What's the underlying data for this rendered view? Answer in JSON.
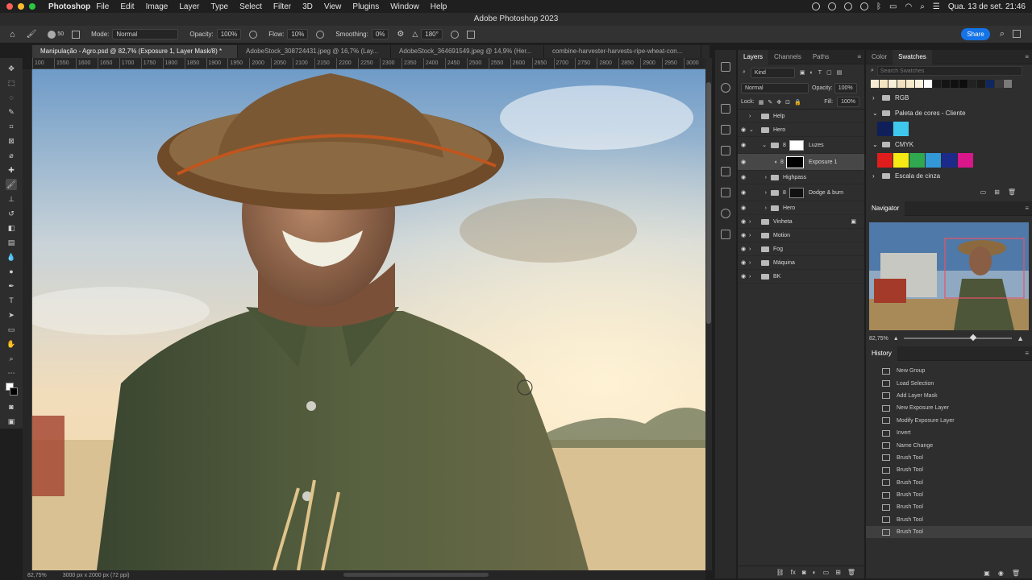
{
  "menubar": {
    "app": "Photoshop",
    "items": [
      "File",
      "Edit",
      "Image",
      "Layer",
      "Type",
      "Select",
      "Filter",
      "3D",
      "View",
      "Plugins",
      "Window",
      "Help"
    ],
    "datetime": "Qua. 13 de set.  21:46"
  },
  "window": {
    "title": "Adobe Photoshop 2023"
  },
  "options": {
    "brush_size": "50",
    "mode_label": "Mode:",
    "mode_value": "Normal",
    "opacity_label": "Opacity:",
    "opacity_value": "100%",
    "flow_label": "Flow:",
    "flow_value": "10%",
    "smoothing_label": "Smoothing:",
    "smoothing_value": "0%",
    "angle_value": "180°",
    "share_label": "Share"
  },
  "tabs": [
    {
      "label": "Manipulação - Agro.psd @ 82,7% (Exposure 1, Layer Mask/8) *"
    },
    {
      "label": "AdobeStock_308724431.jpeg @ 16,7% (Lay..."
    },
    {
      "label": "AdobeStock_364691549.jpeg @ 14,9% (Her..."
    },
    {
      "label": "combine-harvester-harvests-ripe-wheat-con..."
    }
  ],
  "ruler": {
    "ticks": [
      "100",
      "1550",
      "1600",
      "1650",
      "1700",
      "1750",
      "1800",
      "1850",
      "1900",
      "1950",
      "2000",
      "2050",
      "2100",
      "2150",
      "2200",
      "2250",
      "2300",
      "2350",
      "2400",
      "2450",
      "2500",
      "2550",
      "2600",
      "2650",
      "2700",
      "2750",
      "2800",
      "2850",
      "2900",
      "2950",
      "3000"
    ]
  },
  "status": {
    "zoom": "82,75%",
    "doc": "3000 px x 2000 px (72 ppi)"
  },
  "layers_panel": {
    "tabs": [
      "Layers",
      "Channels",
      "Paths"
    ],
    "kind_label": "Kind",
    "blend_mode": "Normal",
    "opacity_label": "Opacity:",
    "opacity_value": "100%",
    "lock_label": "Lock:",
    "fill_label": "Fill:",
    "fill_value": "100%",
    "layers": [
      {
        "name": "Help"
      },
      {
        "name": "Hero"
      },
      {
        "name": "Luzes"
      },
      {
        "name": "Exposure 1"
      },
      {
        "name": "Highpass"
      },
      {
        "name": "Dodge & burn"
      },
      {
        "name": "Hero"
      },
      {
        "name": "Vinheta"
      },
      {
        "name": "Motion"
      },
      {
        "name": "Fog"
      },
      {
        "name": "Máquina"
      },
      {
        "name": "BK"
      }
    ]
  },
  "swatches_panel": {
    "tabs": [
      "Color",
      "Swatches"
    ],
    "search_placeholder": "Search Swatches",
    "groups": [
      "RGB",
      "Paleta de cores - Cliente",
      "CMYK",
      "Escala de cinza"
    ],
    "recent_colors": [
      "#f6ead0",
      "#f3e3c1",
      "#f8efd8",
      "#efe0bf",
      "#f7e9cc",
      "#fbf3e0",
      "#ffffff",
      "#1b1b1b",
      "#141414",
      "#101010",
      "#0d0d0d",
      "#222222",
      "#1a1a1a",
      "#10265e",
      "#3a3a3a",
      "#7a7a7a"
    ],
    "client_colors": [
      "#0e1f5a",
      "#3fc8ee"
    ],
    "cmyk_colors": [
      "#e01d1d",
      "#f5ea14",
      "#2fa84f",
      "#3399d6",
      "#1c2a8a",
      "#d9168a"
    ]
  },
  "navigator": {
    "title": "Navigator",
    "zoom": "82,75%"
  },
  "history": {
    "title": "History",
    "items": [
      "New Group",
      "Load Selection",
      "Add Layer Mask",
      "New Exposure Layer",
      "Modify Exposure Layer",
      "Invert",
      "Name Change",
      "Brush Tool",
      "Brush Tool",
      "Brush Tool",
      "Brush Tool",
      "Brush Tool",
      "Brush Tool",
      "Brush Tool"
    ]
  }
}
